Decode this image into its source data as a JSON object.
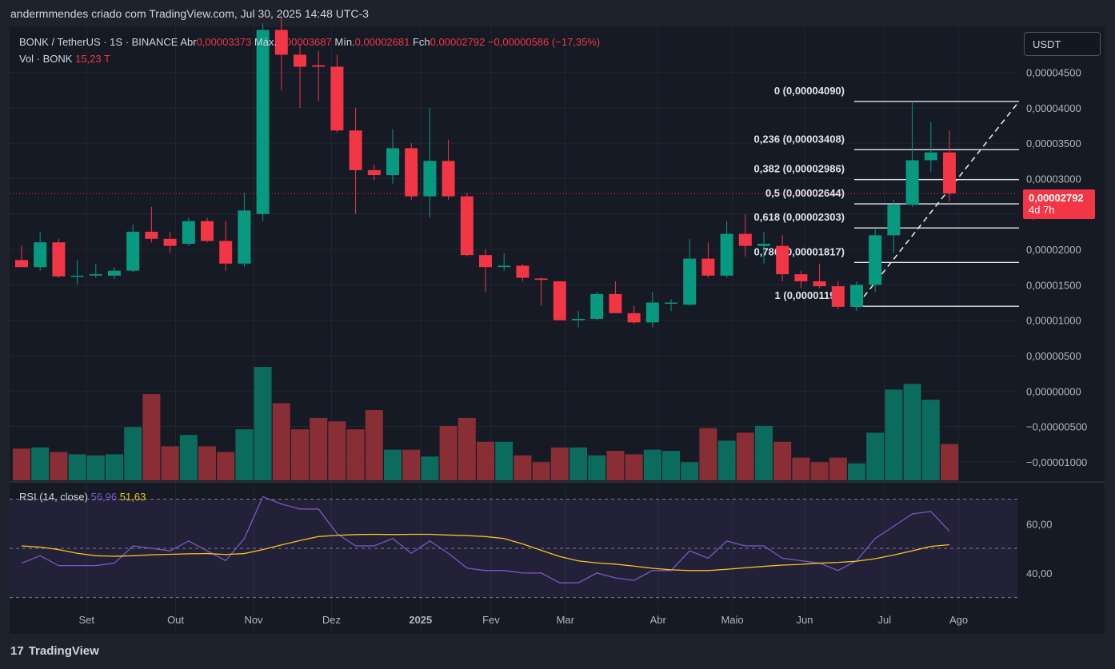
{
  "header": {
    "attribution": "andermmendes criado com TradingView.com, Jul 30, 2025 14:48 UTC-3"
  },
  "legend": {
    "symbol": "BONK / TetherUS · 1S · BINANCE",
    "open_label": "Abr",
    "open_value": "0,00003373",
    "high_label": "Máx.",
    "high_value": "0,00003687",
    "low_label": "Mín.",
    "low_value": "0,00002681",
    "close_label": "Fch",
    "close_value": "0,00002792",
    "change": "−0,00000586 (−17,35%)",
    "vol_label": "Vol · BONK",
    "vol_value": "15,23 T",
    "rsi_label": "RSI (14, close)",
    "rsi_value": "56,96",
    "rsi_ma_value": "51,63"
  },
  "currency_button": "USDT",
  "price_badge": {
    "price": "0,00002792",
    "countdown": "4d 7h"
  },
  "footer": {
    "brand": "TradingView",
    "logo_text": "17"
  },
  "colors": {
    "up": "#089981",
    "down": "#f23645",
    "rsi": "#7e57c2",
    "rsi_ma": "#f7c325",
    "bg": "#161a25"
  },
  "chart_data": {
    "type": "candlestick",
    "ylim": [
      -1.25e-05,
      5.15e-05
    ],
    "y_ticks": [
      "0,00004500",
      "0,00004000",
      "0,00003500",
      "0,00003000",
      "0,00002500",
      "0,00002000",
      "0,00001500",
      "0,00001000",
      "0,00000500",
      "0,00000000",
      "−0,00000500",
      "−0,00001000"
    ],
    "y_tick_values": [
      4.5e-05,
      4e-05,
      3.5e-05,
      3e-05,
      2.5e-05,
      2e-05,
      1.5e-05,
      1e-05,
      5e-06,
      0,
      -5e-06,
      -1e-05
    ],
    "x_labels": [
      "Set",
      "Out",
      "Nov",
      "Dez",
      "2025",
      "Fev",
      "Mar",
      "Abr",
      "Maio",
      "Jun",
      "Jul",
      "Ago"
    ],
    "x_label_index": [
      3.5,
      8.3,
      12.5,
      16.7,
      21.5,
      25.3,
      29.3,
      34.3,
      38.3,
      42.2,
      46.5,
      50.5
    ],
    "candles": [
      {
        "o": 1.85e-05,
        "h": 2.05e-05,
        "l": 1.75e-05,
        "c": 1.75e-05,
        "v": 0.28
      },
      {
        "o": 1.75e-05,
        "h": 2.25e-05,
        "l": 1.7e-05,
        "c": 2.1e-05,
        "v": 0.29
      },
      {
        "o": 2.1e-05,
        "h": 2.15e-05,
        "l": 1.6e-05,
        "c": 1.62e-05,
        "v": 0.25
      },
      {
        "o": 1.62e-05,
        "h": 1.85e-05,
        "l": 1.5e-05,
        "c": 1.63e-05,
        "v": 0.23
      },
      {
        "o": 1.63e-05,
        "h": 1.8e-05,
        "l": 1.6e-05,
        "c": 1.65e-05,
        "v": 0.22
      },
      {
        "o": 1.63e-05,
        "h": 1.75e-05,
        "l": 1.58e-05,
        "c": 1.7e-05,
        "v": 0.23
      },
      {
        "o": 1.7e-05,
        "h": 2.35e-05,
        "l": 1.68e-05,
        "c": 2.25e-05,
        "v": 0.47
      },
      {
        "o": 2.25e-05,
        "h": 2.6e-05,
        "l": 2.1e-05,
        "c": 2.15e-05,
        "v": 0.76
      },
      {
        "o": 2.15e-05,
        "h": 2.25e-05,
        "l": 1.95e-05,
        "c": 2.05e-05,
        "v": 0.3
      },
      {
        "o": 2.08e-05,
        "h": 2.45e-05,
        "l": 2.05e-05,
        "c": 2.4e-05,
        "v": 0.4
      },
      {
        "o": 2.4e-05,
        "h": 2.45e-05,
        "l": 2.1e-05,
        "c": 2.12e-05,
        "v": 0.3
      },
      {
        "o": 2.12e-05,
        "h": 2.4e-05,
        "l": 1.7e-05,
        "c": 1.8e-05,
        "v": 0.25
      },
      {
        "o": 1.8e-05,
        "h": 2.8e-05,
        "l": 1.75e-05,
        "c": 2.55e-05,
        "v": 0.45
      },
      {
        "o": 2.5e-05,
        "h": 5.19e-05,
        "l": 2.4e-05,
        "c": 5.1e-05,
        "v": 1.0
      },
      {
        "o": 5.1e-05,
        "h": 5.3e-05,
        "l": 4.25e-05,
        "c": 4.75e-05,
        "v": 0.68
      },
      {
        "o": 4.75e-05,
        "h": 4.9e-05,
        "l": 4e-05,
        "c": 4.58e-05,
        "v": 0.45
      },
      {
        "o": 4.6e-05,
        "h": 4.8e-05,
        "l": 4.1e-05,
        "c": 4.58e-05,
        "v": 0.55
      },
      {
        "o": 4.58e-05,
        "h": 4.75e-05,
        "l": 3.65e-05,
        "c": 3.68e-05,
        "v": 0.52
      },
      {
        "o": 3.68e-05,
        "h": 4e-05,
        "l": 2.5e-05,
        "c": 3.12e-05,
        "v": 0.45
      },
      {
        "o": 3.12e-05,
        "h": 3.2e-05,
        "l": 2.98e-05,
        "c": 3.05e-05,
        "v": 0.62
      },
      {
        "o": 3.05e-05,
        "h": 3.7e-05,
        "l": 2.93e-05,
        "c": 3.43e-05,
        "v": 0.27
      },
      {
        "o": 3.43e-05,
        "h": 3.5e-05,
        "l": 2.7e-05,
        "c": 2.75e-05,
        "v": 0.27
      },
      {
        "o": 2.75e-05,
        "h": 4e-05,
        "l": 2.45e-05,
        "c": 3.25e-05,
        "v": 0.21
      },
      {
        "o": 3.25e-05,
        "h": 3.55e-05,
        "l": 2.7e-05,
        "c": 2.75e-05,
        "v": 0.48
      },
      {
        "o": 2.75e-05,
        "h": 2.8e-05,
        "l": 1.9e-05,
        "c": 1.92e-05,
        "v": 0.55
      },
      {
        "o": 1.92e-05,
        "h": 2e-05,
        "l": 1.4e-05,
        "c": 1.75e-05,
        "v": 0.34
      },
      {
        "o": 1.75e-05,
        "h": 1.95e-05,
        "l": 1.7e-05,
        "c": 1.77e-05,
        "v": 0.34
      },
      {
        "o": 1.77e-05,
        "h": 1.8e-05,
        "l": 1.55e-05,
        "c": 1.6e-05,
        "v": 0.22
      },
      {
        "o": 1.59e-05,
        "h": 1.6e-05,
        "l": 1.2e-05,
        "c": 1.57e-05,
        "v": 0.16
      },
      {
        "o": 1.55e-05,
        "h": 1.55e-05,
        "l": 1e-05,
        "c": 1e-05,
        "v": 0.29
      },
      {
        "o": 1e-05,
        "h": 1.13e-05,
        "l": 9e-06,
        "c": 1.02e-05,
        "v": 0.29
      },
      {
        "o": 1.02e-05,
        "h": 1.4e-05,
        "l": 1e-05,
        "c": 1.37e-05,
        "v": 0.22
      },
      {
        "o": 1.37e-05,
        "h": 1.55e-05,
        "l": 1.1e-05,
        "c": 1.1e-05,
        "v": 0.26
      },
      {
        "o": 1.1e-05,
        "h": 1.2e-05,
        "l": 9.5e-06,
        "c": 9.7e-06,
        "v": 0.23
      },
      {
        "o": 9.7e-06,
        "h": 1.4e-05,
        "l": 9e-06,
        "c": 1.25e-05,
        "v": 0.27
      },
      {
        "o": 1.25e-05,
        "h": 1.3e-05,
        "l": 1.13e-05,
        "c": 1.25e-05,
        "v": 0.26
      },
      {
        "o": 1.22e-05,
        "h": 2.15e-05,
        "l": 1.2e-05,
        "c": 1.87e-05,
        "v": 0.16
      },
      {
        "o": 1.87e-05,
        "h": 2.1e-05,
        "l": 1.6e-05,
        "c": 1.63e-05,
        "v": 0.46
      },
      {
        "o": 1.63e-05,
        "h": 2.4e-05,
        "l": 1.6e-05,
        "c": 2.22e-05,
        "v": 0.35
      },
      {
        "o": 2.22e-05,
        "h": 2.5e-05,
        "l": 1.9e-05,
        "c": 2.05e-05,
        "v": 0.42
      },
      {
        "o": 2.05e-05,
        "h": 2.25e-05,
        "l": 1.8e-05,
        "c": 2.08e-05,
        "v": 0.48
      },
      {
        "o": 2.05e-05,
        "h": 2.2e-05,
        "l": 1.55e-05,
        "c": 1.65e-05,
        "v": 0.34
      },
      {
        "o": 1.65e-05,
        "h": 1.7e-05,
        "l": 1.45e-05,
        "c": 1.55e-05,
        "v": 0.2
      },
      {
        "o": 1.55e-05,
        "h": 1.8e-05,
        "l": 1.45e-05,
        "c": 1.48e-05,
        "v": 0.16
      },
      {
        "o": 1.48e-05,
        "h": 1.55e-05,
        "l": 1.15e-05,
        "c": 1.19e-05,
        "v": 0.2
      },
      {
        "o": 1.19e-05,
        "h": 1.55e-05,
        "l": 1.13e-05,
        "c": 1.5e-05,
        "v": 0.15
      },
      {
        "o": 1.5e-05,
        "h": 2.3e-05,
        "l": 1.4e-05,
        "c": 2.2e-05,
        "v": 0.42
      },
      {
        "o": 2.2e-05,
        "h": 2.7e-05,
        "l": 1.95e-05,
        "c": 2.63e-05,
        "v": 0.8
      },
      {
        "o": 2.63e-05,
        "h": 4.09e-05,
        "l": 2.6e-05,
        "c": 3.26e-05,
        "v": 0.85
      },
      {
        "o": 3.26e-05,
        "h": 3.8e-05,
        "l": 3.1e-05,
        "c": 3.37e-05,
        "v": 0.71
      },
      {
        "o": 3.37e-05,
        "h": 3.68e-05,
        "l": 2.68e-05,
        "c": 2.79e-05,
        "v": 0.32
      }
    ],
    "fib_levels": [
      {
        "label": "0 (0,00004090)",
        "value": 4.09e-05
      },
      {
        "label": "0,236 (0,00003408)",
        "value": 3.408e-05
      },
      {
        "label": "0,382 (0,00002986)",
        "value": 2.986e-05
      },
      {
        "label": "0,5 (0,00002644)",
        "value": 2.644e-05
      },
      {
        "label": "0,618 (0,00002303)",
        "value": 2.303e-05
      },
      {
        "label": "0,786 (0,00001817)",
        "value": 1.817e-05
      },
      {
        "label": "1 (0,00001197)",
        "value": 1.197e-05
      }
    ],
    "rsi": {
      "ylim": [
        26,
        76
      ],
      "y_ticks": [
        "60,00",
        "40,00"
      ],
      "y_tick_values": [
        60,
        40
      ],
      "bands": [
        70,
        50,
        30
      ],
      "values": [
        44,
        47,
        43,
        43,
        43,
        44,
        51,
        50,
        49,
        53,
        49,
        45,
        54,
        71,
        68,
        66,
        66,
        56,
        51,
        51,
        54,
        48,
        53,
        48,
        42,
        41,
        41,
        40,
        40,
        36,
        36,
        40,
        38,
        37,
        41,
        41,
        49,
        46,
        53,
        51,
        51,
        46,
        45,
        44,
        41,
        45,
        54,
        59,
        64,
        65,
        57
      ],
      "ma": [
        51,
        50.5,
        49.5,
        48,
        47,
        46.8,
        47,
        47.4,
        47.6,
        47.8,
        47.9,
        47.5,
        47.9,
        49.5,
        51.4,
        53.2,
        54.8,
        55.3,
        55.6,
        55.7,
        55.6,
        55.7,
        55.7,
        55.4,
        55.2,
        54.8,
        54,
        51.8,
        49.2,
        46.7,
        44.9,
        44.1,
        43.6,
        42.8,
        41.9,
        41.3,
        41,
        41,
        41.5,
        42.1,
        42.7,
        43.2,
        43.5,
        44,
        44.3,
        44.8,
        45.8,
        47.3,
        49,
        50.8,
        51.5
      ]
    }
  }
}
